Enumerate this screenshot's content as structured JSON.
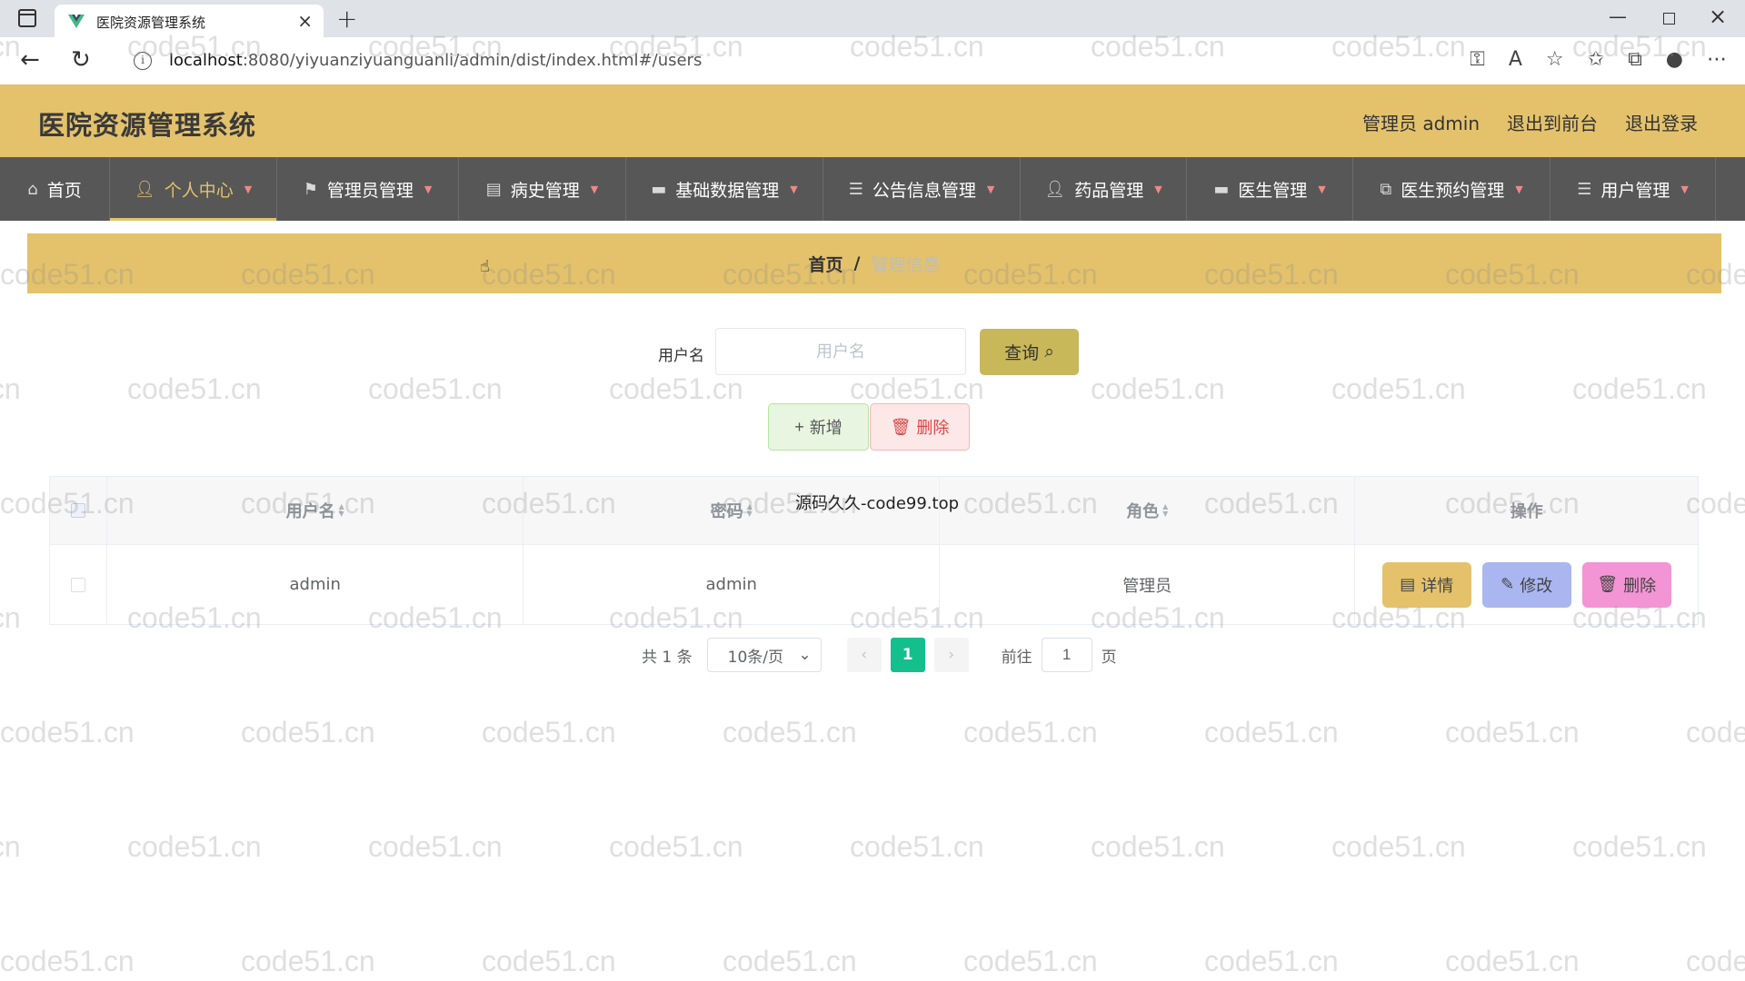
{
  "browser": {
    "tab_title": "医院资源管理系统",
    "url_host": "localhost",
    "url_rest": ":8080/yiyuanziyuanguanli/admin/dist/index.html#/users"
  },
  "header": {
    "title": "医院资源管理系统",
    "user_label": "管理员 admin",
    "to_front": "退出到前台",
    "logout": "退出登录"
  },
  "nav": {
    "items": [
      {
        "label": "首页",
        "icon": "home-icon"
      },
      {
        "label": "个人中心",
        "icon": "user-icon"
      },
      {
        "label": "管理员管理",
        "icon": "flag-icon"
      },
      {
        "label": "病史管理",
        "icon": "clipboard-icon"
      },
      {
        "label": "基础数据管理",
        "icon": "chat-icon"
      },
      {
        "label": "公告信息管理",
        "icon": "list-icon"
      },
      {
        "label": "药品管理",
        "icon": "user-icon"
      },
      {
        "label": "医生管理",
        "icon": "chat-icon"
      },
      {
        "label": "医生预约管理",
        "icon": "copy-icon"
      },
      {
        "label": "用户管理",
        "icon": "list-icon"
      }
    ]
  },
  "breadcrumb": {
    "home": "首页",
    "separator": "/",
    "current": "管理信息"
  },
  "search": {
    "label": "用户名",
    "placeholder": "用户名",
    "query_label": "查询"
  },
  "actions": {
    "add_label": "新增",
    "delete_label": "删除"
  },
  "table": {
    "columns": [
      "用户名",
      "密码",
      "角色",
      "操作"
    ],
    "rows": [
      {
        "username": "admin",
        "password": "admin",
        "role": "管理员"
      }
    ],
    "ops": {
      "detail": "详情",
      "edit": "修改",
      "delete": "删除"
    }
  },
  "overlay_text": "源码久久-code99.top",
  "watermark_text": "code51.cn",
  "pagination": {
    "total": "共 1 条",
    "page_size": "10条/页",
    "current_page": "1",
    "goto_prefix": "前往",
    "goto_value": "1",
    "goto_suffix": "页"
  },
  "colors": {
    "accent": "#e4c26b",
    "nav_bg": "#575757",
    "query_btn": "#c8b85a",
    "page_active": "#13c08c",
    "edit_btn": "#a9b6f0",
    "delete_btn": "#f394d4"
  }
}
